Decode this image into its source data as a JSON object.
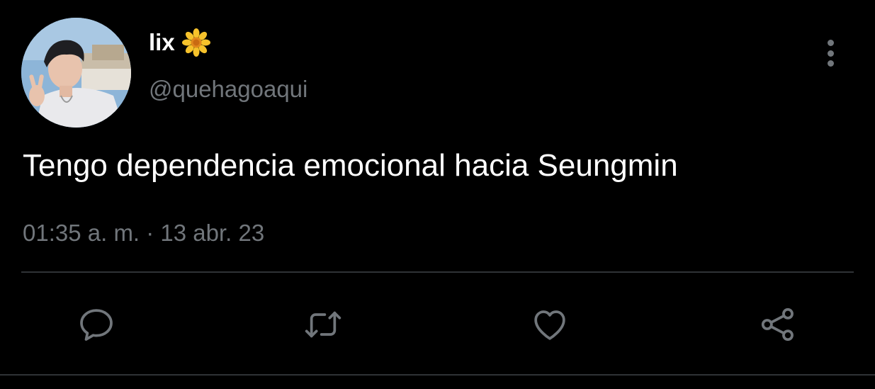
{
  "user": {
    "display_name": "lix",
    "handle": "@quehagoaqui",
    "name_emoji": "sunflower-icon"
  },
  "tweet": {
    "text": "Tengo dependencia emocional hacia Seungmin",
    "timestamp": "01:35 a. m. · 13 abr. 23"
  },
  "actions": [
    "reply-icon",
    "retweet-icon",
    "like-icon",
    "share-icon"
  ],
  "colors": {
    "background": "#000000",
    "text_primary": "#ffffff",
    "text_secondary": "#71767b",
    "divider": "#2f3336"
  }
}
